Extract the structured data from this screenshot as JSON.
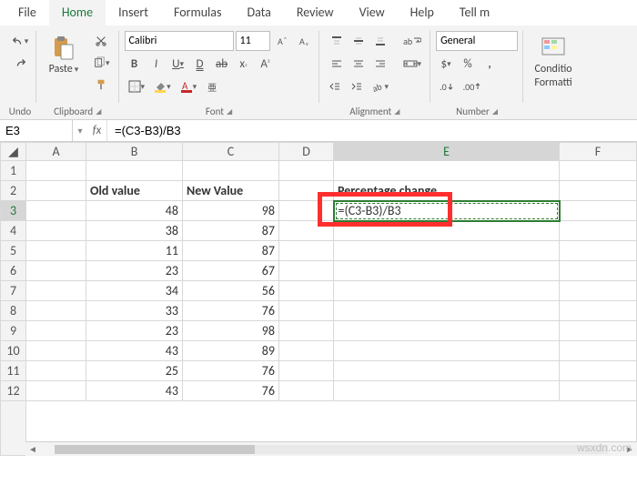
{
  "tabs": {
    "file": "File",
    "home": "Home",
    "insert": "Insert",
    "formulas": "Formulas",
    "data": "Data",
    "review": "Review",
    "view": "View",
    "help": "Help",
    "tellme": "Tell m"
  },
  "ribbon": {
    "undo": {
      "label": "Undo"
    },
    "clipboard": {
      "paste": "Paste",
      "label": "Clipboard"
    },
    "font": {
      "name": "Calibri",
      "size": "11",
      "bold": "B",
      "italic": "I",
      "underline": "U",
      "double_underline": "D",
      "label": "Font"
    },
    "alignment": {
      "wrap": "ab",
      "label": "Alignment"
    },
    "number": {
      "format": "General",
      "label": "Number"
    },
    "styles": {
      "conditional": "Conditio",
      "formatting": "Formatti"
    }
  },
  "namebox": "E3",
  "formula_fx": "fx",
  "formula": "=(C3-B3)/B3",
  "columns": [
    "A",
    "B",
    "C",
    "D",
    "E",
    "F"
  ],
  "headers": {
    "b": "Old value",
    "c": "New Value",
    "e": "Percentage change"
  },
  "rows": [
    {
      "r": 1,
      "b": "",
      "c": "",
      "e": ""
    },
    {
      "r": 2,
      "b": "Old value",
      "c": "New Value",
      "e": "Percentage change",
      "isHeader": true
    },
    {
      "r": 3,
      "b": 48,
      "c": 98,
      "e": "=(C3-B3)/B3"
    },
    {
      "r": 4,
      "b": 38,
      "c": 87,
      "e": ""
    },
    {
      "r": 5,
      "b": 11,
      "c": 87,
      "e": ""
    },
    {
      "r": 6,
      "b": 23,
      "c": 67,
      "e": ""
    },
    {
      "r": 7,
      "b": 34,
      "c": 56,
      "e": ""
    },
    {
      "r": 8,
      "b": 33,
      "c": 76,
      "e": ""
    },
    {
      "r": 9,
      "b": 23,
      "c": 98,
      "e": ""
    },
    {
      "r": 10,
      "b": 43,
      "c": 89,
      "e": ""
    },
    {
      "r": 11,
      "b": 25,
      "c": 76,
      "e": ""
    },
    {
      "r": 12,
      "b": 43,
      "c": 76,
      "e": ""
    }
  ],
  "selected_cell": "E3",
  "watermark": "wsxdn.com"
}
